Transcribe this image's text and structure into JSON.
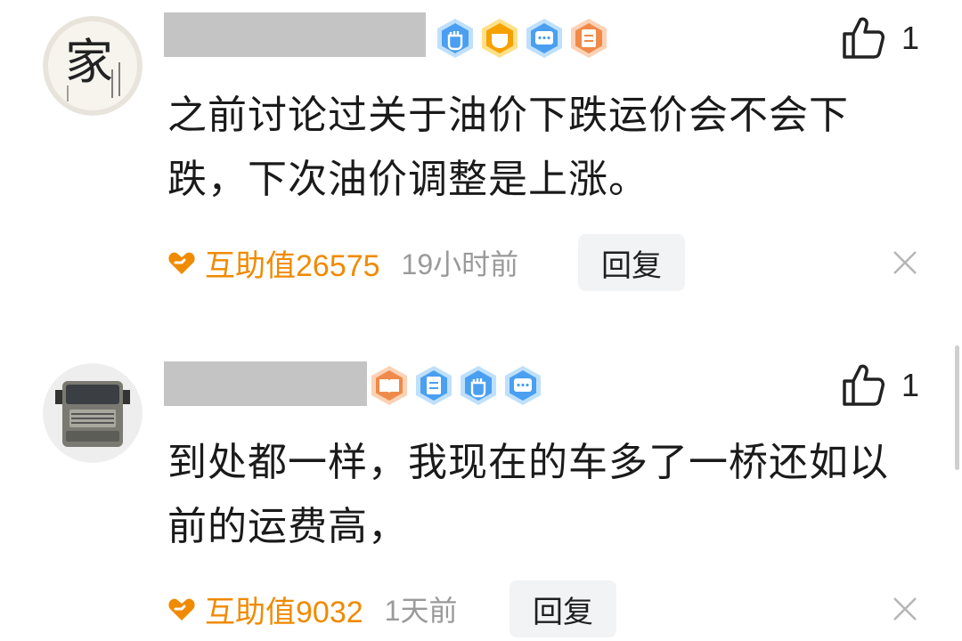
{
  "comments": [
    {
      "content": "之前讨论过关于油价下跌运价会不会下跌，下次油价调整是上涨。",
      "avatar_text": "家",
      "likes": "1",
      "help_value": "互助值26575",
      "time": "19小时前",
      "reply_label": "回复",
      "badges": [
        "fist-badge-blue",
        "gold-medal-badge",
        "chat-badge-blue",
        "document-badge-orange"
      ]
    },
    {
      "content": "到处都一样，我现在的车多了一桥还如以前的运费高，",
      "likes": "1",
      "help_value": "互助值9032",
      "time": "1天前",
      "reply_label": "回复",
      "badges": [
        "book-badge-orange",
        "document-badge-blue",
        "fist-badge-blue",
        "chat-badge-blue"
      ]
    }
  ],
  "colors": {
    "help_orange": "#f08a00",
    "badge_blue": "#4a9ff0",
    "badge_orange": "#ef8a4a",
    "time_gray": "#9a9a9a"
  }
}
